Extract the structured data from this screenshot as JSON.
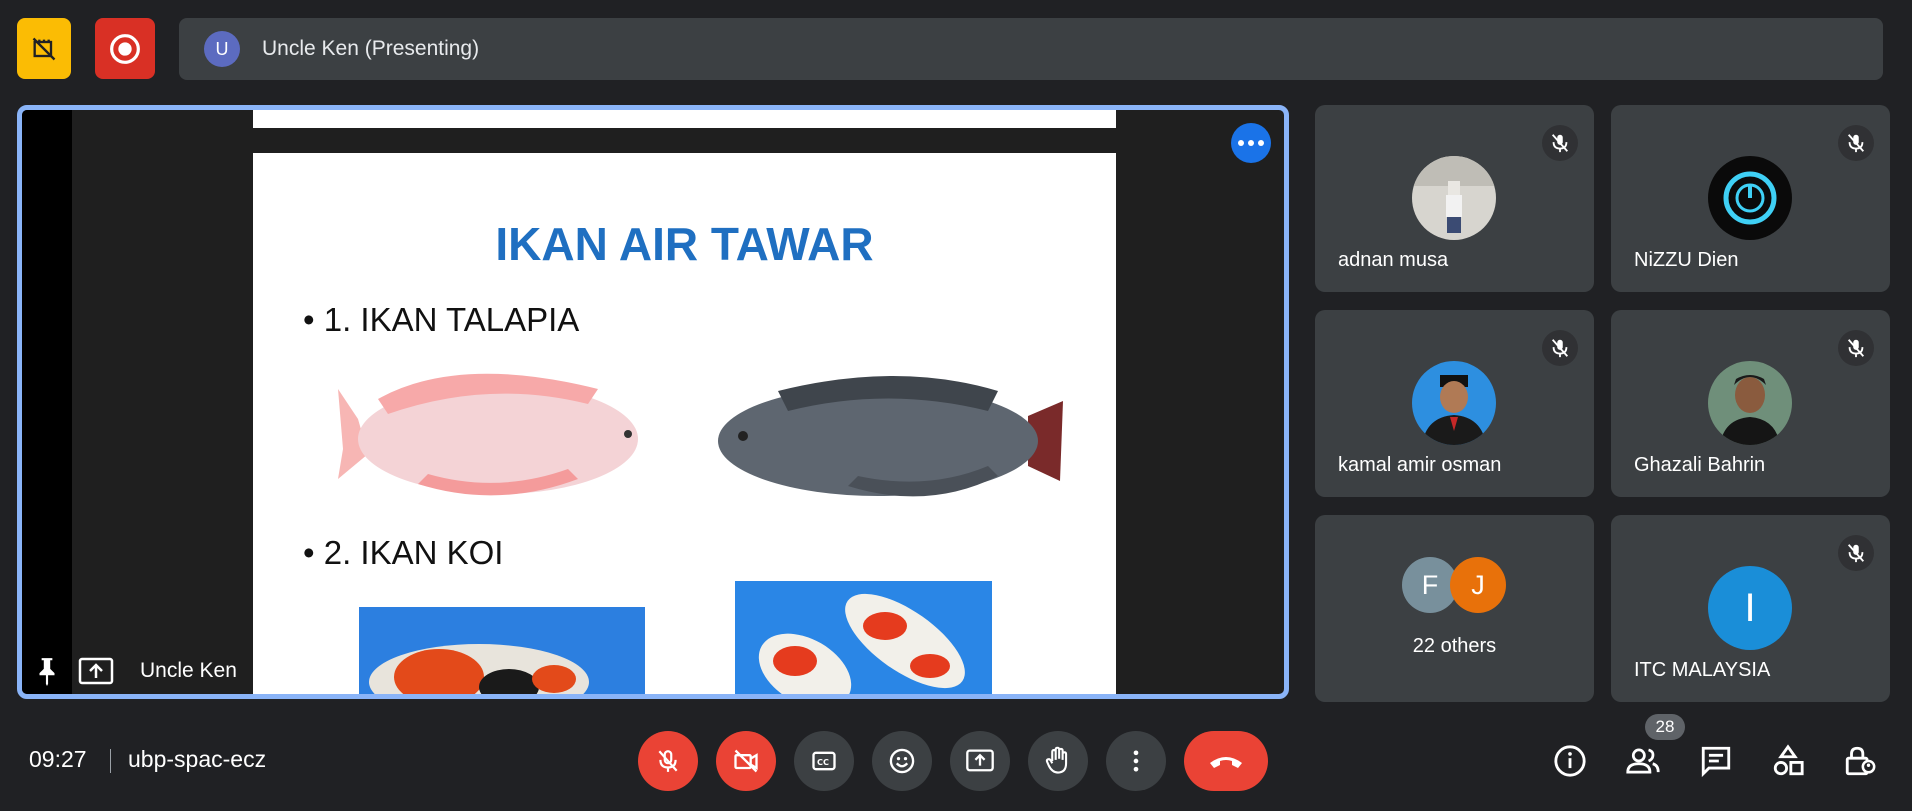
{
  "presenter_bar": {
    "avatar_letter": "U",
    "label": "Uncle Ken (Presenting)"
  },
  "stage": {
    "presenter_name": "Uncle Ken",
    "slide": {
      "title": "IKAN AIR TAWAR",
      "bullets": [
        "1. IKAN TALAPIA",
        "2. IKAN KOI"
      ]
    }
  },
  "participants": [
    {
      "name": "adnan musa",
      "muted": true
    },
    {
      "name": "NiZZU Dien",
      "muted": true
    },
    {
      "name": "kamal amir osman",
      "muted": true
    },
    {
      "name": "Ghazali Bahrin",
      "muted": true
    },
    {
      "name": "ITC MALAYSIA",
      "muted": true,
      "avatar_letter": "I"
    }
  ],
  "others": {
    "avatar_letters": [
      "F",
      "J"
    ],
    "label": "22 others"
  },
  "bottom_bar": {
    "time": "09:27",
    "meeting_code": "ubp-spac-ecz",
    "people_count": "28"
  },
  "colors": {
    "background": "#202124",
    "tile": "#3c4043",
    "active_border": "#8ab4f8",
    "danger": "#ea4335",
    "warning": "#fbbc04",
    "slide_title": "#1f6fc1"
  }
}
